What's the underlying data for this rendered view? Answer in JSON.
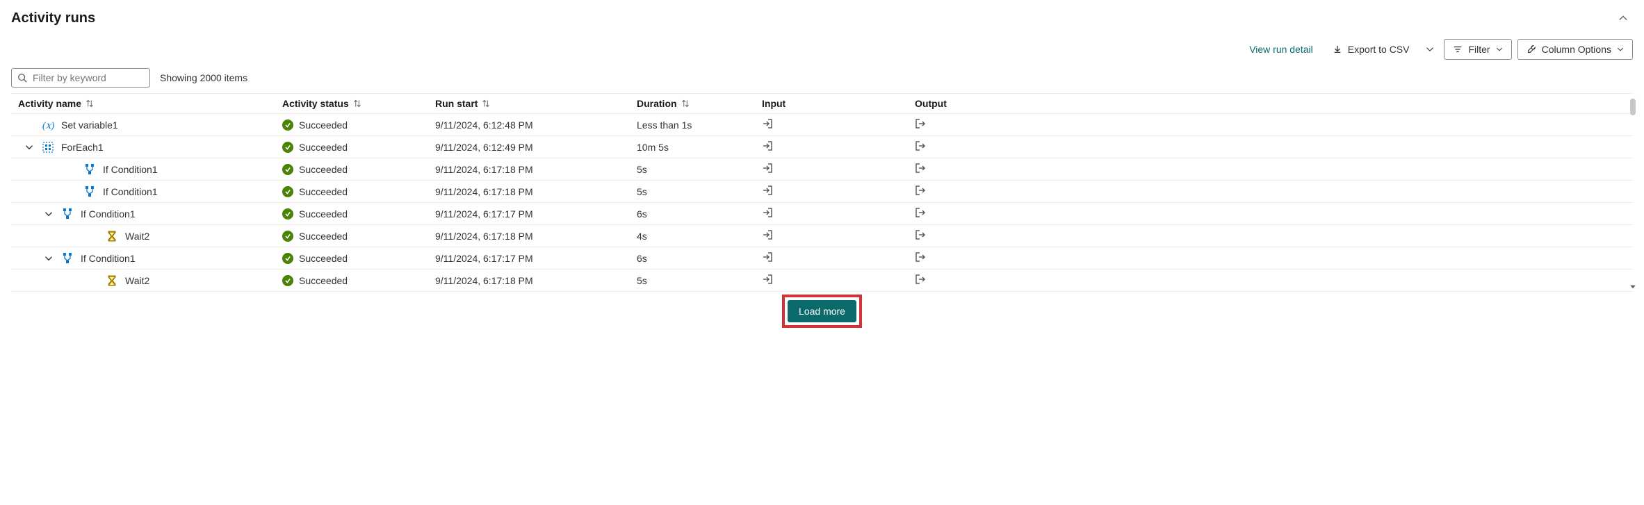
{
  "title": "Activity runs",
  "toolbar": {
    "view_detail": "View run detail",
    "export_csv": "Export to CSV",
    "filter": "Filter",
    "column_options": "Column Options"
  },
  "filter": {
    "placeholder": "Filter by keyword",
    "count_text": "Showing 2000 items"
  },
  "columns": {
    "activity": "Activity name",
    "status": "Activity status",
    "run_start": "Run start",
    "duration": "Duration",
    "input": "Input",
    "output": "Output"
  },
  "load_more": "Load more",
  "rows": [
    {
      "indent": 0,
      "expander": "none",
      "icon": "variable",
      "name": "Set variable1",
      "status": "Succeeded",
      "run_start": "9/11/2024, 6:12:48 PM",
      "duration": "Less than 1s"
    },
    {
      "indent": 0,
      "expander": "down",
      "icon": "foreach",
      "name": "ForEach1",
      "status": "Succeeded",
      "run_start": "9/11/2024, 6:12:49 PM",
      "duration": "10m 5s"
    },
    {
      "indent": 2,
      "expander": "none",
      "icon": "ifcond",
      "name": "If Condition1",
      "status": "Succeeded",
      "run_start": "9/11/2024, 6:17:18 PM",
      "duration": "5s"
    },
    {
      "indent": 2,
      "expander": "none",
      "icon": "ifcond",
      "name": "If Condition1",
      "status": "Succeeded",
      "run_start": "9/11/2024, 6:17:18 PM",
      "duration": "5s"
    },
    {
      "indent": 1,
      "expander": "down",
      "icon": "ifcond",
      "name": "If Condition1",
      "status": "Succeeded",
      "run_start": "9/11/2024, 6:17:17 PM",
      "duration": "6s"
    },
    {
      "indent": 3,
      "expander": "none",
      "icon": "wait",
      "name": "Wait2",
      "status": "Succeeded",
      "run_start": "9/11/2024, 6:17:18 PM",
      "duration": "4s"
    },
    {
      "indent": 1,
      "expander": "down",
      "icon": "ifcond",
      "name": "If Condition1",
      "status": "Succeeded",
      "run_start": "9/11/2024, 6:17:17 PM",
      "duration": "6s"
    },
    {
      "indent": 3,
      "expander": "none",
      "icon": "wait",
      "name": "Wait2",
      "status": "Succeeded",
      "run_start": "9/11/2024, 6:17:18 PM",
      "duration": "5s"
    }
  ]
}
